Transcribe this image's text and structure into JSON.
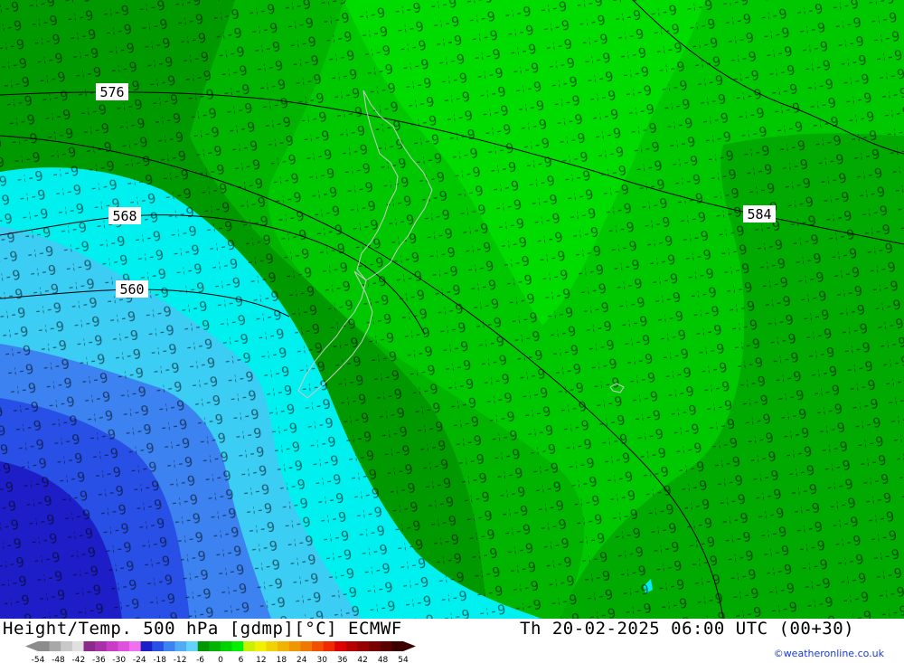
{
  "title": "Height/Temp. 500 hPa [gdmp][°C] ECMWF",
  "datetime": "Th 20-02-2025 06:00 UTC (00+30)",
  "credit": "©weatheronline.co.uk",
  "contour_labels": [
    "576",
    "584",
    "568",
    "560"
  ],
  "legend": {
    "ticks": [
      "-54",
      "-48",
      "-42",
      "-36",
      "-30",
      "-24",
      "-18",
      "-12",
      "-6",
      "0",
      "6",
      "12",
      "18",
      "24",
      "30",
      "36",
      "42",
      "48",
      "54"
    ],
    "colors": [
      "#8c8c8c",
      "#a8a8a8",
      "#c8c8c8",
      "#e0e0e0",
      "#8a2a8a",
      "#a830a8",
      "#c83cc8",
      "#e050e0",
      "#f070f0",
      "#1e1ec8",
      "#2850e6",
      "#3c82f0",
      "#50aaf5",
      "#64d2fa",
      "#009600",
      "#00b400",
      "#00d200",
      "#00f000",
      "#c8f000",
      "#f0f000",
      "#f0d200",
      "#f0b400",
      "#f09600",
      "#f07800",
      "#f05000",
      "#f02800",
      "#dc0000",
      "#b40000",
      "#960000",
      "#780000",
      "#5a0000",
      "#3c0000"
    ]
  }
}
